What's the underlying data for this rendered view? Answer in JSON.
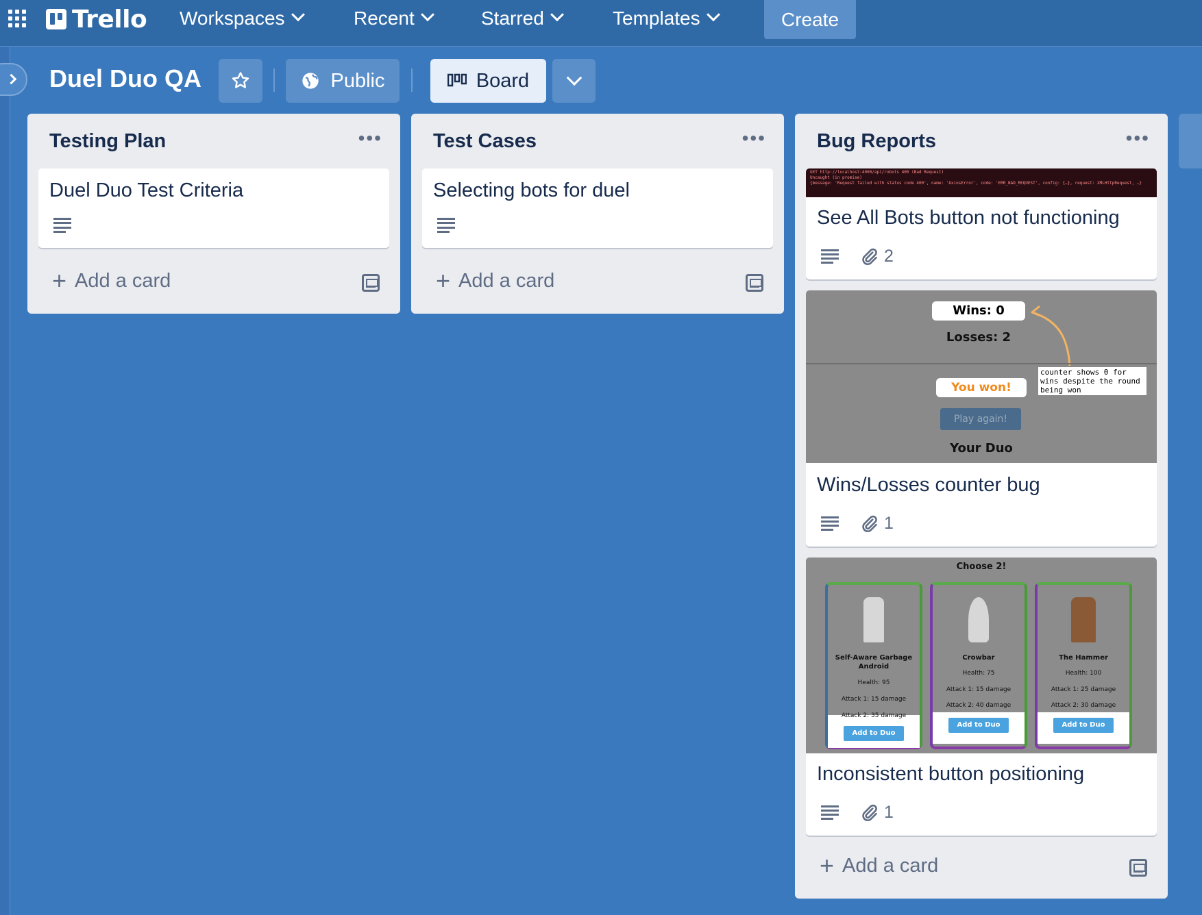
{
  "header": {
    "logo": "Trello",
    "nav": [
      {
        "label": "Workspaces"
      },
      {
        "label": "Recent"
      },
      {
        "label": "Starred"
      },
      {
        "label": "Templates"
      }
    ],
    "create_label": "Create",
    "bg_color": "#306aa6"
  },
  "board": {
    "title": "Duel Duo QA",
    "visibility_label": "Public",
    "view_label": "Board",
    "bg_color": "#3a79bd"
  },
  "lists": [
    {
      "title": "Testing Plan",
      "cards": [
        {
          "title": "Duel Duo Test Criteria",
          "has_description": true
        }
      ],
      "add_label": "Add a card"
    },
    {
      "title": "Test Cases",
      "cards": [
        {
          "title": "Selecting bots for duel",
          "has_description": true
        }
      ],
      "add_label": "Add a card"
    },
    {
      "title": "Bug Reports",
      "cards": [
        {
          "title": "See All Bots button not functioning",
          "has_description": true,
          "attachments": "2"
        },
        {
          "title": "Wins/Losses counter bug",
          "has_description": true,
          "attachments": "1"
        },
        {
          "title": "Inconsistent button positioning",
          "has_description": true,
          "attachments": "1"
        }
      ],
      "add_label": "Add a card"
    }
  ],
  "covers": {
    "console": {
      "lines": [
        "GET http://localhost:4000/api/robots 400 (Bad Request)",
        "Uncaught (in promise)",
        "{message: 'Request failed with status code 400', name: 'AxiosError', code: 'ERR_BAD_REQUEST', config: {…}, request: XMLHttpRequest, …}"
      ]
    },
    "wins": {
      "wins": "Wins: 0",
      "losses": "Losses: 2",
      "you_won": "You won!",
      "play_again": "Play again!",
      "your_duo": "Your Duo",
      "annotation": "counter shows 0 for wins despite the round being won"
    },
    "bots": {
      "heading": "Choose 2!",
      "cards": [
        {
          "name": "Self-Aware Garbage Android",
          "health": "Health: 95",
          "attack1": "Attack 1: 15 damage",
          "attack2": "Attack 2: 35 damage",
          "button": "Add to Duo"
        },
        {
          "name": "Crowbar",
          "health": "Health: 75",
          "attack1": "Attack 1: 15 damage",
          "attack2": "Attack 2: 40 damage",
          "button": "Add to Duo"
        },
        {
          "name": "The Hammer",
          "health": "Health: 100",
          "attack1": "Attack 1: 25 damage",
          "attack2": "Attack 2: 30 damage",
          "button": "Add to Duo"
        }
      ]
    }
  }
}
